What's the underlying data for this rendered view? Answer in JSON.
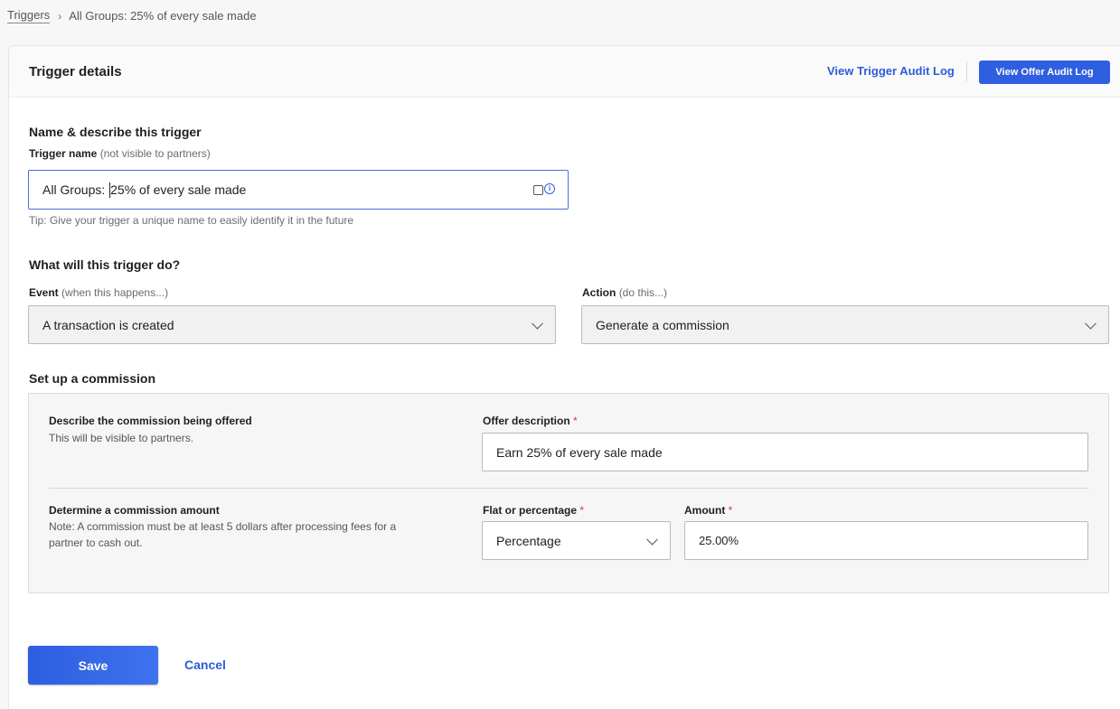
{
  "breadcrumb": {
    "root": "Triggers",
    "current": "All Groups: 25% of every sale made"
  },
  "header": {
    "title": "Trigger details",
    "trigger_audit_link": "View Trigger Audit Log",
    "offer_audit_button": "View Offer Audit Log"
  },
  "name_section": {
    "title": "Name & describe this trigger",
    "label": "Trigger name",
    "label_note": "(not visible to partners)",
    "value_before_caret": "All Groups: ",
    "value_after_caret": "25% of every sale made",
    "tip": "Tip: Give your trigger a unique name to easily identify it in the future"
  },
  "action_section": {
    "title": "What will this trigger do?",
    "event_label": "Event",
    "event_note": "(when this happens...)",
    "event_value": "A transaction is created",
    "action_label": "Action",
    "action_note": "(do this...)",
    "action_value": "Generate a commission"
  },
  "commission_section": {
    "title": "Set up a commission",
    "describe_title": "Describe the commission being offered",
    "describe_text": "This will be visible to partners.",
    "offer_description_label": "Offer description",
    "offer_description_value": "Earn 25% of every sale made",
    "amount_title": "Determine a commission amount",
    "amount_note_line1": "Note: A commission must be at least 5 dollars after processing fees for a",
    "amount_note_line2": "partner to cash out.",
    "type_label": "Flat or percentage",
    "type_value": "Percentage",
    "amount_label": "Amount",
    "amount_value": "25.00%",
    "required_mark": "*"
  },
  "footer": {
    "save_label": "Save",
    "cancel_label": "Cancel"
  },
  "colors": {
    "accent": "#2f5fe0",
    "link": "#2f5bd8",
    "required": "#d23a3a"
  }
}
